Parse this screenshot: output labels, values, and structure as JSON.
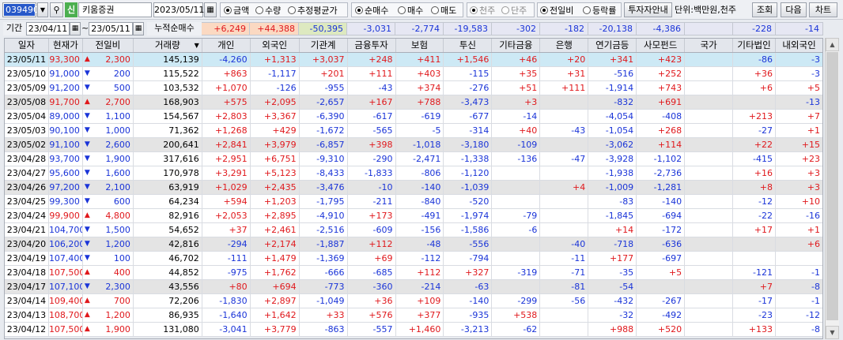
{
  "toolbar": {
    "code": "039490",
    "pin_label": "신",
    "stock_name": "키움증권",
    "date": "2023/05/11",
    "opt_amount": "금액",
    "opt_qty": "수량",
    "opt_avg": "추정평균가",
    "opt_net": "순매수",
    "opt_buy": "매수",
    "opt_sell": "매도",
    "opt_1000": "천주",
    "opt_single": "단주",
    "opt_prev": "전일비",
    "opt_rate": "등락률",
    "info_label": "투자자안내",
    "unit_label": "단위:백만원,천주",
    "query_label": "조회",
    "next_label": "다음",
    "chart_label": "차트"
  },
  "period": {
    "label": "기간",
    "start": "23/04/11",
    "end": "23/05/11",
    "sum_label": "누적순매수",
    "sums": [
      "+6,249",
      "+44,388",
      "-50,395",
      "-3,031",
      "-2,774",
      "-19,583",
      "-302",
      "-182",
      "-20,138",
      "-4,386",
      "",
      "-228",
      "-14"
    ]
  },
  "headers": [
    "일자",
    "현재가",
    "전일비",
    "거래량",
    "개인",
    "외국인",
    "기관계",
    "금융투자",
    "보험",
    "투신",
    "기타금융",
    "은행",
    "연기금등",
    "사모펀드",
    "국가",
    "기타법인",
    "내외국인"
  ],
  "rows": [
    [
      "23/05/11",
      "93,300",
      "up",
      "2,300",
      "145,139",
      "-4,260",
      "+1,313",
      "+3,037",
      "+248",
      "+411",
      "+1,546",
      "+46",
      "+20",
      "+341",
      "+423",
      "",
      "-86",
      "-3"
    ],
    [
      "23/05/10",
      "91,000",
      "dn",
      "200",
      "115,522",
      "+863",
      "-1,117",
      "+201",
      "+111",
      "+403",
      "-115",
      "+35",
      "+31",
      "-516",
      "+252",
      "",
      "+36",
      "-3"
    ],
    [
      "23/05/09",
      "91,200",
      "dn",
      "500",
      "103,532",
      "+1,070",
      "-126",
      "-955",
      "-43",
      "+374",
      "-276",
      "+51",
      "+111",
      "-1,914",
      "+743",
      "",
      "+6",
      "+5"
    ],
    [
      "23/05/08",
      "91,700",
      "up",
      "2,700",
      "168,903",
      "+575",
      "+2,095",
      "-2,657",
      "+167",
      "+788",
      "-3,473",
      "+3",
      "",
      "-832",
      "+691",
      "",
      "",
      "-13"
    ],
    [
      "23/05/04",
      "89,000",
      "dn",
      "1,100",
      "154,567",
      "+2,803",
      "+3,367",
      "-6,390",
      "-617",
      "-619",
      "-677",
      "-14",
      "",
      "-4,054",
      "-408",
      "",
      "+213",
      "+7"
    ],
    [
      "23/05/03",
      "90,100",
      "dn",
      "1,000",
      "71,362",
      "+1,268",
      "+429",
      "-1,672",
      "-565",
      "-5",
      "-314",
      "+40",
      "-43",
      "-1,054",
      "+268",
      "",
      "-27",
      "+1"
    ],
    [
      "23/05/02",
      "91,100",
      "dn",
      "2,600",
      "200,641",
      "+2,841",
      "+3,979",
      "-6,857",
      "+398",
      "-1,018",
      "-3,180",
      "-109",
      "",
      "-3,062",
      "+114",
      "",
      "+22",
      "+15"
    ],
    [
      "23/04/28",
      "93,700",
      "dn",
      "1,900",
      "317,616",
      "+2,951",
      "+6,751",
      "-9,310",
      "-290",
      "-2,471",
      "-1,338",
      "-136",
      "-47",
      "-3,928",
      "-1,102",
      "",
      "-415",
      "+23"
    ],
    [
      "23/04/27",
      "95,600",
      "dn",
      "1,600",
      "170,978",
      "+3,291",
      "+5,123",
      "-8,433",
      "-1,833",
      "-806",
      "-1,120",
      "",
      "",
      "-1,938",
      "-2,736",
      "",
      "+16",
      "+3"
    ],
    [
      "23/04/26",
      "97,200",
      "dn",
      "2,100",
      "63,919",
      "+1,029",
      "+2,435",
      "-3,476",
      "-10",
      "-140",
      "-1,039",
      "",
      "+4",
      "-1,009",
      "-1,281",
      "",
      "+8",
      "+3"
    ],
    [
      "23/04/25",
      "99,300",
      "dn",
      "600",
      "64,234",
      "+594",
      "+1,203",
      "-1,795",
      "-211",
      "-840",
      "-520",
      "",
      "",
      "-83",
      "-140",
      "",
      "-12",
      "+10"
    ],
    [
      "23/04/24",
      "99,900",
      "up",
      "4,800",
      "82,916",
      "+2,053",
      "+2,895",
      "-4,910",
      "+173",
      "-491",
      "-1,974",
      "-79",
      "",
      "-1,845",
      "-694",
      "",
      "-22",
      "-16"
    ],
    [
      "23/04/21",
      "104,700",
      "dn",
      "1,500",
      "54,652",
      "+37",
      "+2,461",
      "-2,516",
      "-609",
      "-156",
      "-1,586",
      "-6",
      "",
      "+14",
      "-172",
      "",
      "+17",
      "+1"
    ],
    [
      "23/04/20",
      "106,200",
      "dn",
      "1,200",
      "42,816",
      "-294",
      "+2,174",
      "-1,887",
      "+112",
      "-48",
      "-556",
      "",
      "-40",
      "-718",
      "-636",
      "",
      "",
      "+6"
    ],
    [
      "23/04/19",
      "107,400",
      "dn",
      "100",
      "46,702",
      "-111",
      "+1,479",
      "-1,369",
      "+69",
      "-112",
      "-794",
      "",
      "-11",
      "+177",
      "-697",
      "",
      "",
      ""
    ],
    [
      "23/04/18",
      "107,500",
      "up",
      "400",
      "44,852",
      "-975",
      "+1,762",
      "-666",
      "-685",
      "+112",
      "+327",
      "-319",
      "-71",
      "-35",
      "+5",
      "",
      "-121",
      "-1"
    ],
    [
      "23/04/17",
      "107,100",
      "dn",
      "2,300",
      "43,556",
      "+80",
      "+694",
      "-773",
      "-360",
      "-214",
      "-63",
      "",
      "-81",
      "-54",
      "",
      "",
      "+7",
      "-8"
    ],
    [
      "23/04/14",
      "109,400",
      "up",
      "700",
      "72,206",
      "-1,830",
      "+2,897",
      "-1,049",
      "+36",
      "+109",
      "-140",
      "-299",
      "-56",
      "-432",
      "-267",
      "",
      "-17",
      "-1"
    ],
    [
      "23/04/13",
      "108,700",
      "up",
      "1,200",
      "86,935",
      "-1,640",
      "+1,642",
      "+33",
      "+576",
      "+377",
      "-935",
      "+538",
      "",
      "-32",
      "-492",
      "",
      "-23",
      "-12"
    ],
    [
      "23/04/12",
      "107,500",
      "up",
      "1,900",
      "131,080",
      "-3,041",
      "+3,779",
      "-863",
      "-557",
      "+1,460",
      "-3,213",
      "-62",
      "",
      "+988",
      "+520",
      "",
      "+133",
      "-8"
    ]
  ]
}
